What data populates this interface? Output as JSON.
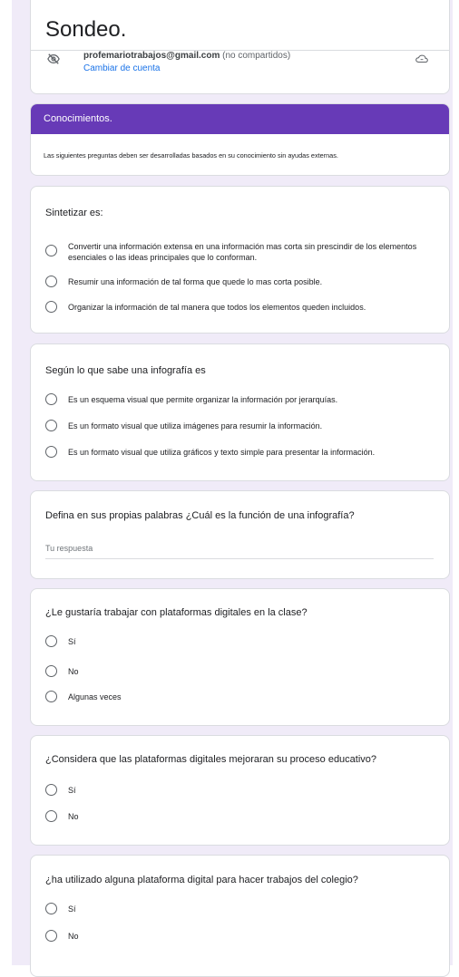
{
  "form": {
    "title": "Sondeo.",
    "account_email": "profemariotrabajos@gmail.com",
    "account_note": "(no compartidos)",
    "switch_account": "Cambiar de cuenta",
    "accent_color": "#673ab7"
  },
  "section": {
    "title": "Conocimientos.",
    "description": "Las siguientes preguntas deben ser desarrolladas basados en su conocimiento sin ayudas externas."
  },
  "questions": [
    {
      "text": "Sintetizar es:",
      "options": [
        "Convertir una información extensa en una información mas corta sin prescindir de los elementos esenciales o las ideas principales que lo conforman.",
        "Resumir una información de tal forma que quede lo mas corta posible.",
        "Organizar la información de tal manera que todos los elementos queden incluidos."
      ]
    },
    {
      "text": "Según lo que sabe una infografía es",
      "options": [
        "Es un esquema visual que permite organizar la información por jerarquías.",
        "Es un formato visual que utiliza imágenes para resumir la información.",
        "Es un formato visual que utiliza gráficos y texto simple para presentar la información."
      ]
    },
    {
      "text": "Defina en sus propias palabras ¿Cuál es la función de una infografía?",
      "placeholder": "Tu respuesta"
    },
    {
      "text": "¿Le gustaría trabajar con plataformas digitales en la clase?",
      "options": [
        "Sí",
        "No",
        "Algunas veces"
      ]
    },
    {
      "text": "¿Considera que las plataformas digitales mejoraran su proceso educativo?",
      "options": [
        "Sí",
        "No"
      ]
    },
    {
      "text": "¿ha utilizado alguna plataforma digital para hacer trabajos del colegio?",
      "options": [
        "Sí",
        "No"
      ]
    }
  ]
}
